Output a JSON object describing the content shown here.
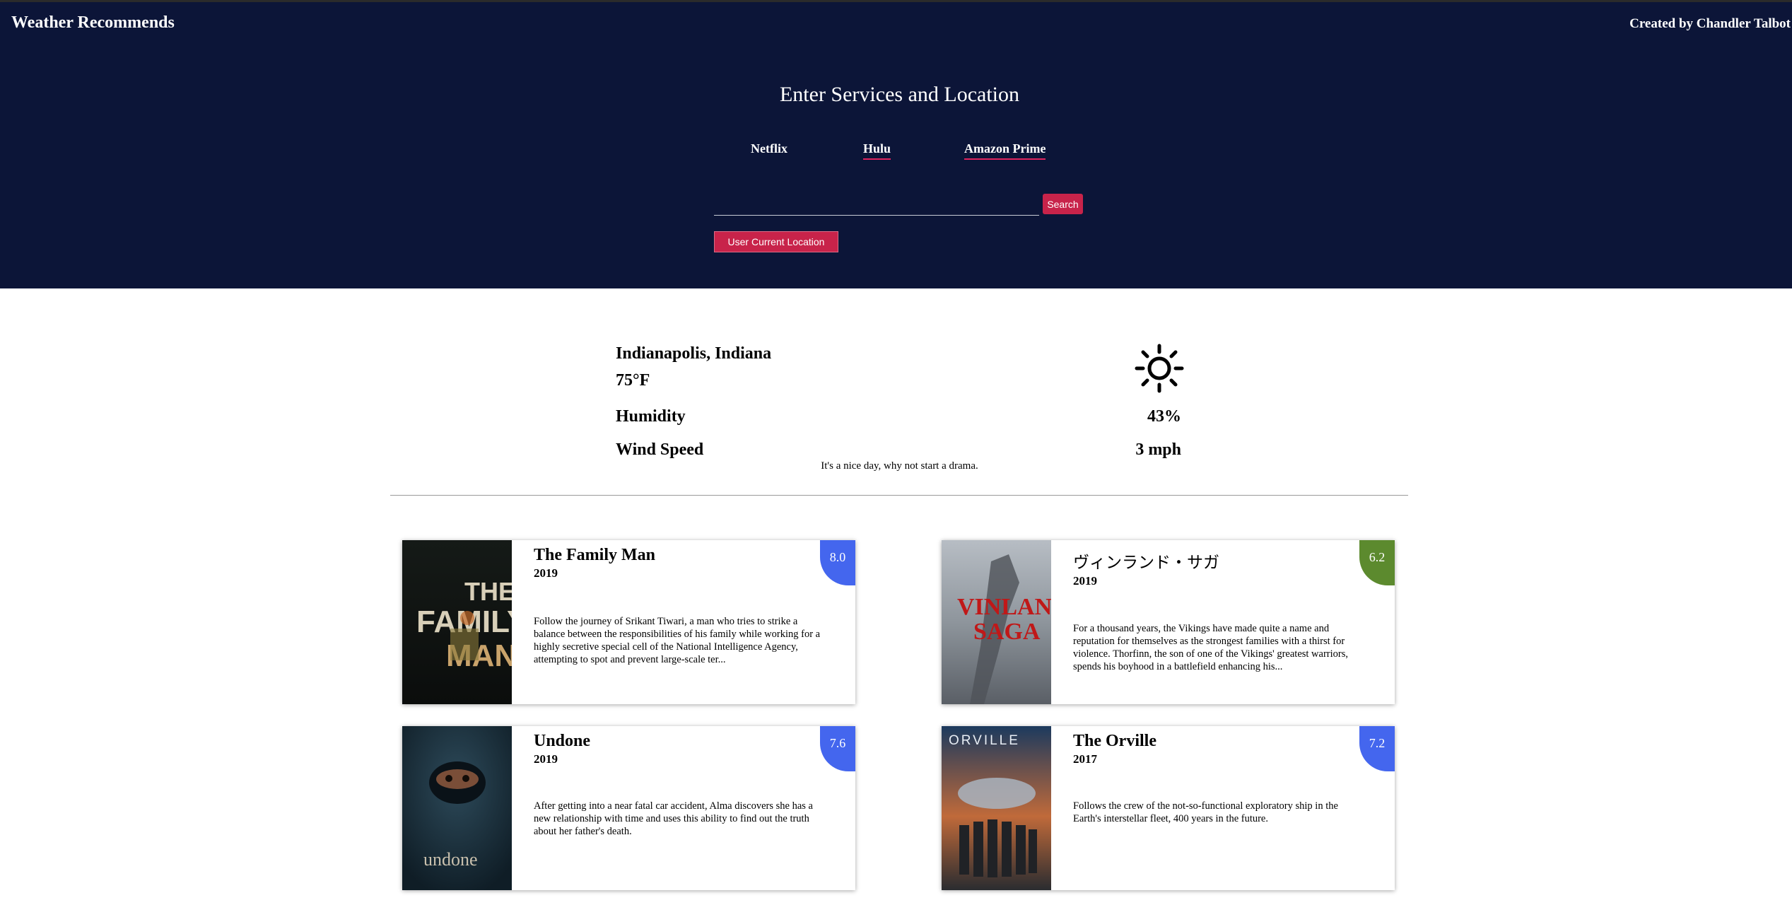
{
  "header": {
    "app_title": "Weather Recommends",
    "credit": "Created by Chandler Talbot",
    "section_title": "Enter Services and Location",
    "services": [
      {
        "label": "Netflix",
        "underlined": false
      },
      {
        "label": "Hulu",
        "underlined": true
      },
      {
        "label": "Amazon Prime",
        "underlined": true
      }
    ],
    "search_value": "",
    "search_button": "Search",
    "location_button": "User Current Location"
  },
  "weather": {
    "city": "Indianapolis, Indiana",
    "temperature": "75°F",
    "icon": "sun-icon",
    "humidity_label": "Humidity",
    "humidity_value": "43%",
    "wind_label": "Wind Speed",
    "wind_value": "3 mph",
    "recommendation": "It's a nice day, why not start a drama."
  },
  "shows": [
    {
      "title": "The Family Man",
      "year": "2019",
      "rating": "8.0",
      "rating_color": "#4466ee",
      "description": "Follow the journey of Srikant Tiwari, a man who tries to strike a balance between the responsibilities of his family while working for a highly secretive special cell of the National Intelligence Agency, attempting to spot and prevent large-scale ter...",
      "poster_text": "THE FAMILY MAN"
    },
    {
      "title": "ヴィンランド・サガ",
      "year": "2019",
      "rating": "6.2",
      "rating_color": "#5c8a2e",
      "description": "For a thousand years, the Vikings have made quite a name and reputation for themselves as the strongest families with a thirst for violence. Thorfinn, the son of one of the Vikings' greatest warriors, spends his boyhood in a battlefield enhancing his...",
      "poster_text": "VINLAND SAGA"
    },
    {
      "title": "Undone",
      "year": "2019",
      "rating": "7.6",
      "rating_color": "#4466ee",
      "description": "After getting into a near fatal car accident, Alma discovers she has a new relationship with time and uses this ability to find out the truth about her father's death.",
      "poster_text": "undone"
    },
    {
      "title": "The Orville",
      "year": "2017",
      "rating": "7.2",
      "rating_color": "#4466ee",
      "description": "Follows the crew of the not-so-functional exploratory ship in the Earth's interstellar fleet, 400 years in the future.",
      "poster_text": "ORVILLE"
    }
  ]
}
